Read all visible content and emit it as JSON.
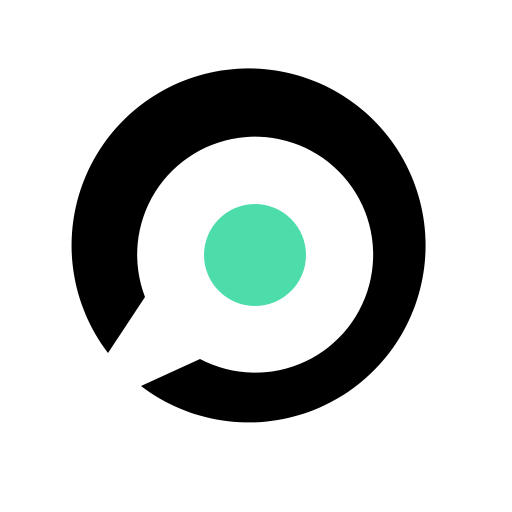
{
  "logo": {
    "icon": "ring-with-dot-logo",
    "colors": {
      "ring": "#000000",
      "dot": "#4DDDAA",
      "background": "#FFFFFF"
    }
  }
}
